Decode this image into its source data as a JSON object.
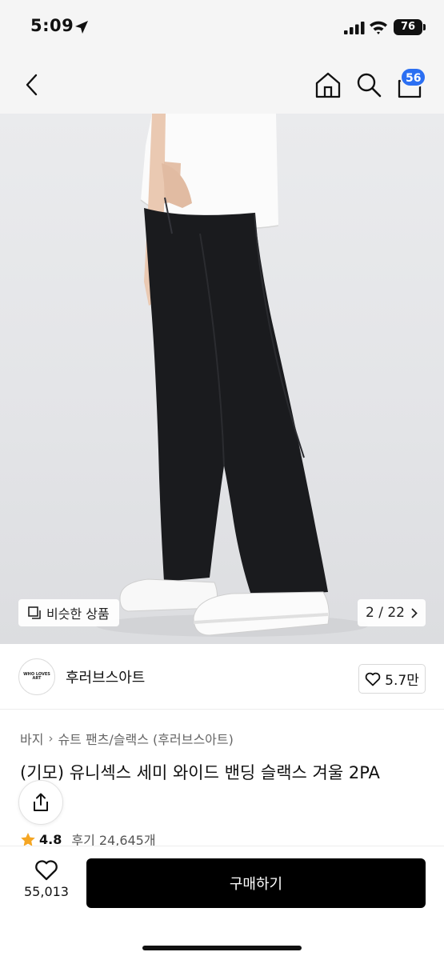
{
  "status_bar": {
    "time": "5:09",
    "battery": "76",
    "icons": [
      "location-arrow-icon",
      "signal-icon",
      "wifi-icon",
      "battery-icon"
    ]
  },
  "nav": {
    "icons": [
      "back-icon",
      "home-icon",
      "search-icon",
      "cart-icon"
    ],
    "cart_badge": "56",
    "badge_color": "#2b6ff2"
  },
  "gallery": {
    "similar_label": "비슷한 상품",
    "counter": "2 / 22"
  },
  "brand": {
    "logo_text": "WHO LOVES ART",
    "name": "후러브스아트",
    "likes": "5.7만"
  },
  "product": {
    "breadcrumb": [
      "바지",
      "슈트 팬츠/슬랙스 (후러브스아트)"
    ],
    "title": "(기모) 유니섹스 세미 와이드 밴딩 슬랙스 겨울 2PA",
    "rating": "4.8",
    "reviews": "후기 24,645개",
    "star_color": "#f5a623"
  },
  "bottom": {
    "wish_count": "55,013",
    "buy_label": "구매하기",
    "buy_color": "#000000"
  }
}
